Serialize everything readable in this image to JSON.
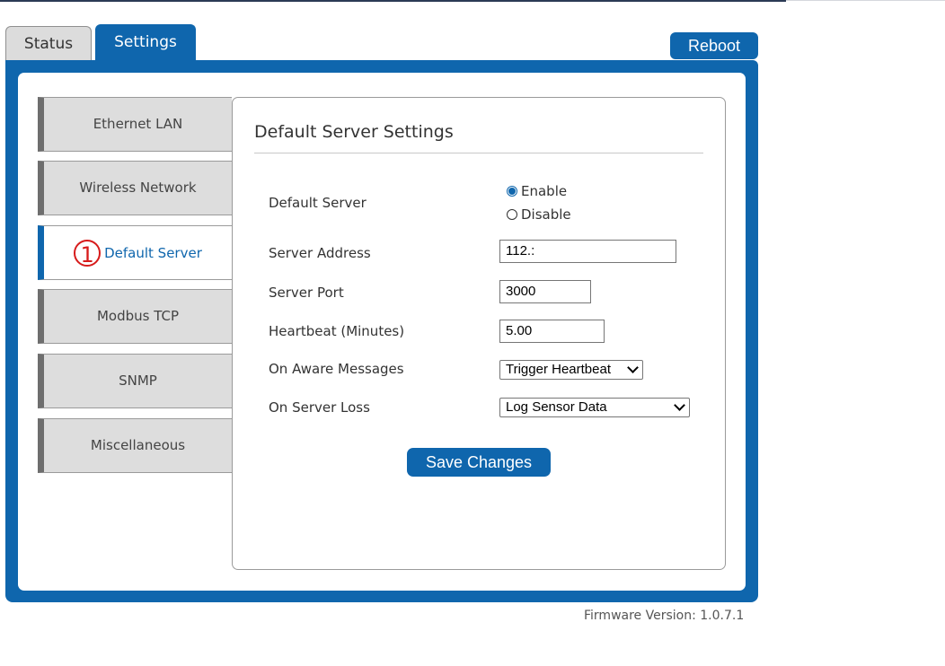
{
  "tabs": [
    {
      "label": "Status",
      "active": false
    },
    {
      "label": "Settings",
      "active": true
    }
  ],
  "reboot_label": "Reboot",
  "nav": [
    {
      "label": "Ethernet LAN",
      "active": false
    },
    {
      "label": "Wireless Network",
      "active": false
    },
    {
      "label": "Default Server",
      "active": true,
      "marker": "1"
    },
    {
      "label": "Modbus TCP",
      "active": false
    },
    {
      "label": "SNMP",
      "active": false
    },
    {
      "label": "Miscellaneous",
      "active": false
    }
  ],
  "panel": {
    "title": "Default Server Settings",
    "default_server": {
      "label": "Default Server",
      "options": [
        "Enable",
        "Disable"
      ],
      "selected": "Enable"
    },
    "server_address": {
      "label": "Server Address",
      "value": "112.:"
    },
    "server_port": {
      "label": "Server Port",
      "value": "3000"
    },
    "heartbeat": {
      "label": "Heartbeat (Minutes)",
      "value": "5.00"
    },
    "on_aware": {
      "label": "On Aware Messages",
      "value": "Trigger Heartbeat"
    },
    "on_loss": {
      "label": "On Server Loss",
      "value": "Log Sensor Data"
    },
    "save_label": "Save Changes"
  },
  "footer": {
    "firmware": "Firmware Version: 1.0.7.1"
  },
  "colors": {
    "accent": "#0f66ad",
    "marker": "#d71b1b",
    "nav_bg": "#dddddd"
  }
}
